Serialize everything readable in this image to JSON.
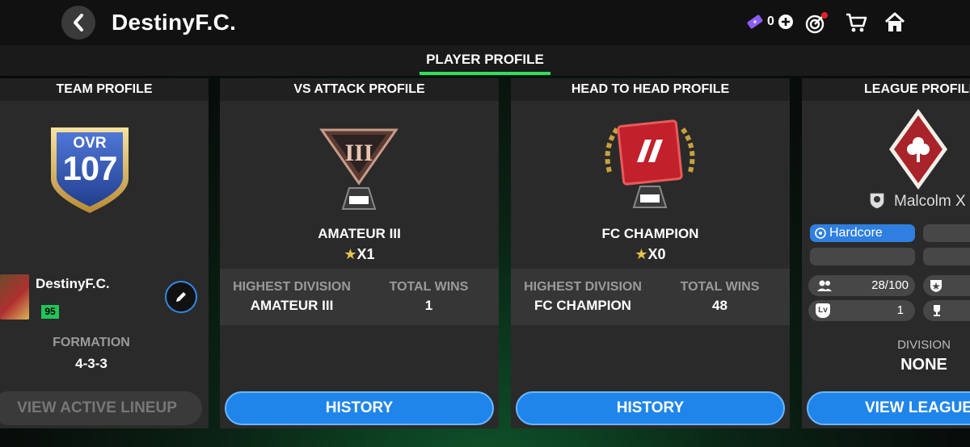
{
  "header": {
    "title": "DestinyF.C.",
    "currency_count": "0"
  },
  "tabs": {
    "active_label": "PLAYER PROFILE"
  },
  "team_profile": {
    "title": "TEAM PROFILE",
    "ovr_label": "OVR",
    "ovr_value": "107",
    "team_name": "DestinyF.C.",
    "team_rating": "95",
    "formation_label": "FORMATION",
    "formation_value": "4-3-3",
    "button_label": "VIEW ACTIVE LINEUP"
  },
  "vs_attack": {
    "title": "VS ATTACK PROFILE",
    "rank_name": "AMATEUR III",
    "rank_stars": "X1",
    "highest_division_label": "HIGHEST DIVISION",
    "highest_division_value": "AMATEUR III",
    "total_wins_label": "TOTAL WINS",
    "total_wins_value": "1",
    "button_label": "HISTORY"
  },
  "head_to_head": {
    "title": "HEAD TO HEAD PROFILE",
    "rank_name": "FC CHAMPION",
    "rank_stars": "X0",
    "highest_division_label": "HIGHEST DIVISION",
    "highest_division_value": "FC CHAMPION",
    "total_wins_label": "TOTAL WINS",
    "total_wins_value": "48",
    "button_label": "HISTORY"
  },
  "league": {
    "title": "LEAGUE PROFILE",
    "leader_name": "Malcolm X",
    "tag": "Hardcore",
    "members": "28/100",
    "level": "1",
    "division_label": "DIVISION",
    "division_value": "NONE",
    "button_label": "VIEW LEAGUE"
  },
  "colors": {
    "accent_green": "#2de05f",
    "button_blue": "#1f85ea",
    "tag_blue": "#2f7fe0",
    "rating_green": "#22c45a"
  }
}
